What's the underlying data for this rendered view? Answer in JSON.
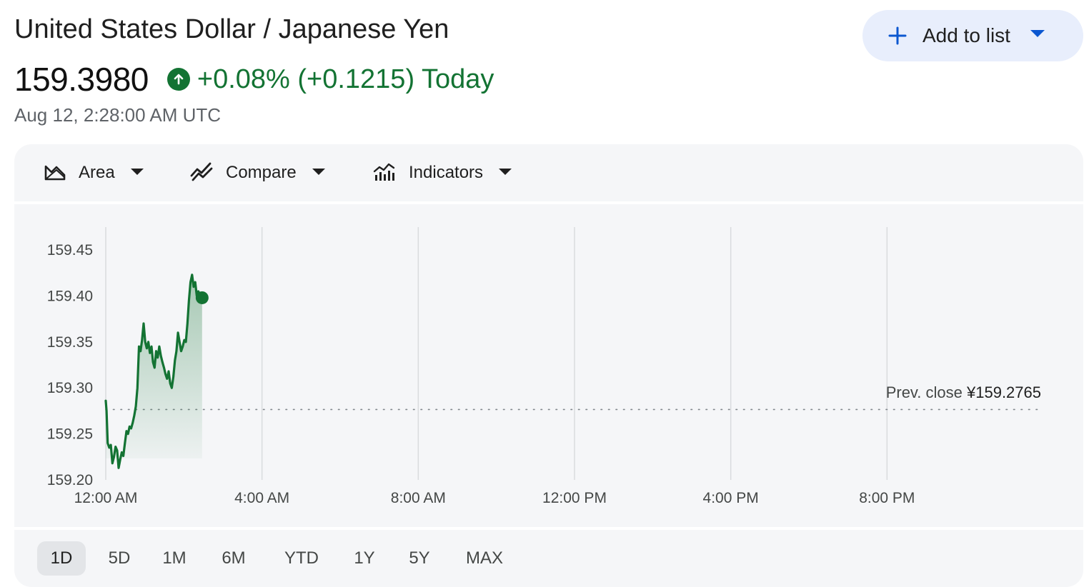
{
  "header": {
    "title": "United States Dollar / Japanese Yen",
    "price": "159.3980",
    "change": "+0.08% (+0.1215) Today",
    "timestamp": "Aug 12, 2:28:00 AM UTC",
    "add_to_list": "Add to list"
  },
  "toolbar": {
    "area_label": "Area",
    "compare_label": "Compare",
    "indicators_label": "Indicators"
  },
  "ranges": [
    "1D",
    "5D",
    "1M",
    "6M",
    "YTD",
    "1Y",
    "5Y",
    "MAX"
  ],
  "active_range": "1D",
  "colors": {
    "up": "#137333",
    "accent": "#0b57d0",
    "panel": "#f5f6f8"
  },
  "chart_data": {
    "type": "area",
    "title": "",
    "xlabel": "",
    "ylabel": "",
    "x_ticks": [
      "12:00 AM",
      "4:00 AM",
      "8:00 AM",
      "12:00 PM",
      "4:00 PM",
      "8:00 PM"
    ],
    "y_ticks": [
      "159.45",
      "159.40",
      "159.35",
      "159.30",
      "159.25",
      "159.20"
    ],
    "ylim": [
      159.2,
      159.45
    ],
    "xlim_hours": [
      0,
      24
    ],
    "grid": "vertical",
    "prev_close": 159.2765,
    "prev_close_label": "Prev. close",
    "prev_close_value": "¥159.2765",
    "last_point": {
      "hour": 2.4667,
      "value": 159.398
    },
    "series": [
      {
        "values": [
          [
            0.0,
            159.286
          ],
          [
            0.02,
            159.275
          ],
          [
            0.05,
            159.24
          ],
          [
            0.09,
            159.235
          ],
          [
            0.13,
            159.238
          ],
          [
            0.17,
            159.218
          ],
          [
            0.21,
            159.225
          ],
          [
            0.25,
            159.236
          ],
          [
            0.29,
            159.232
          ],
          [
            0.33,
            159.213
          ],
          [
            0.37,
            159.222
          ],
          [
            0.41,
            159.23
          ],
          [
            0.45,
            159.226
          ],
          [
            0.49,
            159.24
          ],
          [
            0.53,
            159.253
          ],
          [
            0.57,
            159.25
          ],
          [
            0.61,
            159.258
          ],
          [
            0.65,
            159.256
          ],
          [
            0.69,
            159.262
          ],
          [
            0.73,
            159.27
          ],
          [
            0.77,
            159.28
          ],
          [
            0.81,
            159.3
          ],
          [
            0.85,
            159.345
          ],
          [
            0.89,
            159.34
          ],
          [
            0.93,
            159.352
          ],
          [
            0.97,
            159.37
          ],
          [
            1.01,
            159.35
          ],
          [
            1.05,
            159.343
          ],
          [
            1.09,
            159.35
          ],
          [
            1.13,
            159.338
          ],
          [
            1.17,
            159.345
          ],
          [
            1.21,
            159.328
          ],
          [
            1.25,
            159.322
          ],
          [
            1.29,
            159.34
          ],
          [
            1.33,
            159.333
          ],
          [
            1.37,
            159.345
          ],
          [
            1.41,
            159.335
          ],
          [
            1.45,
            159.328
          ],
          [
            1.49,
            159.322
          ],
          [
            1.53,
            159.315
          ],
          [
            1.57,
            159.31
          ],
          [
            1.61,
            159.318
          ],
          [
            1.65,
            159.305
          ],
          [
            1.69,
            159.3
          ],
          [
            1.73,
            159.312
          ],
          [
            1.77,
            159.33
          ],
          [
            1.81,
            159.34
          ],
          [
            1.85,
            159.36
          ],
          [
            1.89,
            159.35
          ],
          [
            1.93,
            159.34
          ],
          [
            1.97,
            159.345
          ],
          [
            2.01,
            159.352
          ],
          [
            2.05,
            159.35
          ],
          [
            2.09,
            159.37
          ],
          [
            2.13,
            159.395
          ],
          [
            2.17,
            159.415
          ],
          [
            2.21,
            159.423
          ],
          [
            2.25,
            159.41
          ],
          [
            2.29,
            159.415
          ],
          [
            2.33,
            159.4
          ],
          [
            2.37,
            159.405
          ],
          [
            2.42,
            159.4
          ],
          [
            2.4667,
            159.398
          ]
        ]
      }
    ]
  }
}
